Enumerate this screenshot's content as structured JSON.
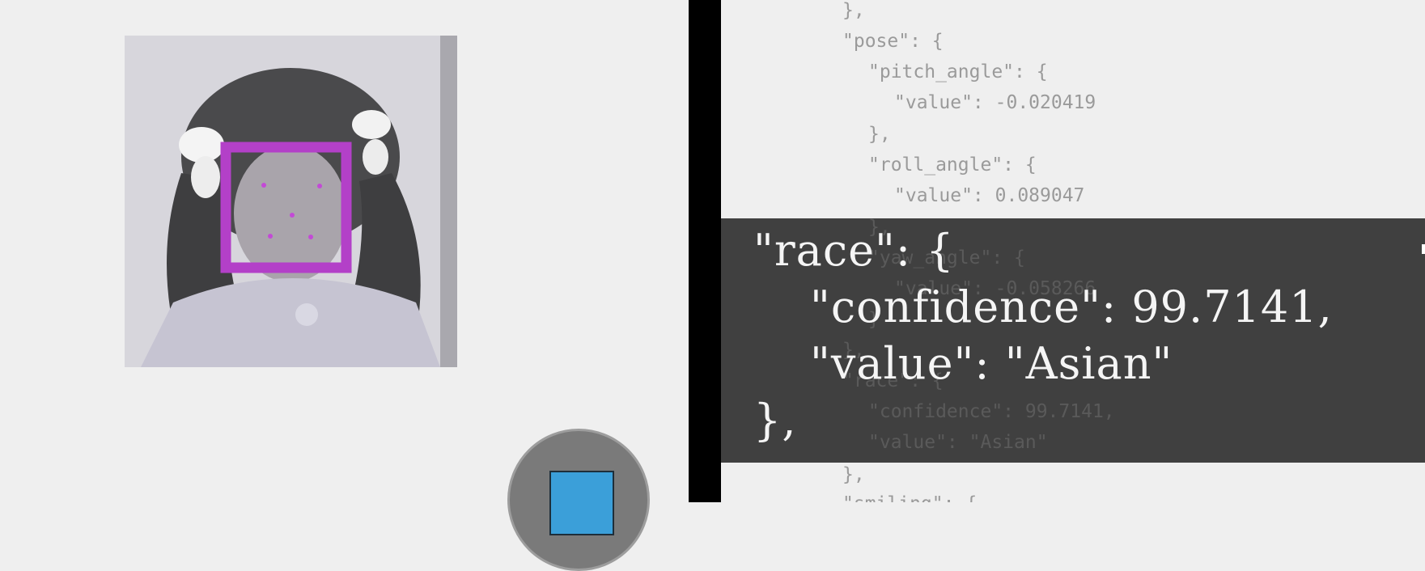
{
  "code_panel": {
    "lines": [
      "},",
      "\"pose\": {",
      "\"pitch_angle\": {",
      "\"value\": -0.020419",
      "},",
      "\"roll_angle\": {",
      "\"value\": 0.089047",
      "},",
      "\"yaw_angle\": {",
      "\"value\": -0.058266",
      "}",
      "},",
      "\"race\": {",
      "\"confidence\": 99.7141,",
      "\"value\": \"Asian\"",
      "},",
      "\"smiling\": {"
    ]
  },
  "callout": {
    "line1": "\"race\": {",
    "line2": "\"confidence\": 99.7141,",
    "line3": "\"value\": \"Asian\"",
    "line4": "},"
  },
  "colors": {
    "face_box": "#b340c8",
    "stop_button": "#3b9fd9",
    "callout_bg": "#3a3a3a"
  },
  "icons": {
    "stop": "stop-square-icon"
  }
}
